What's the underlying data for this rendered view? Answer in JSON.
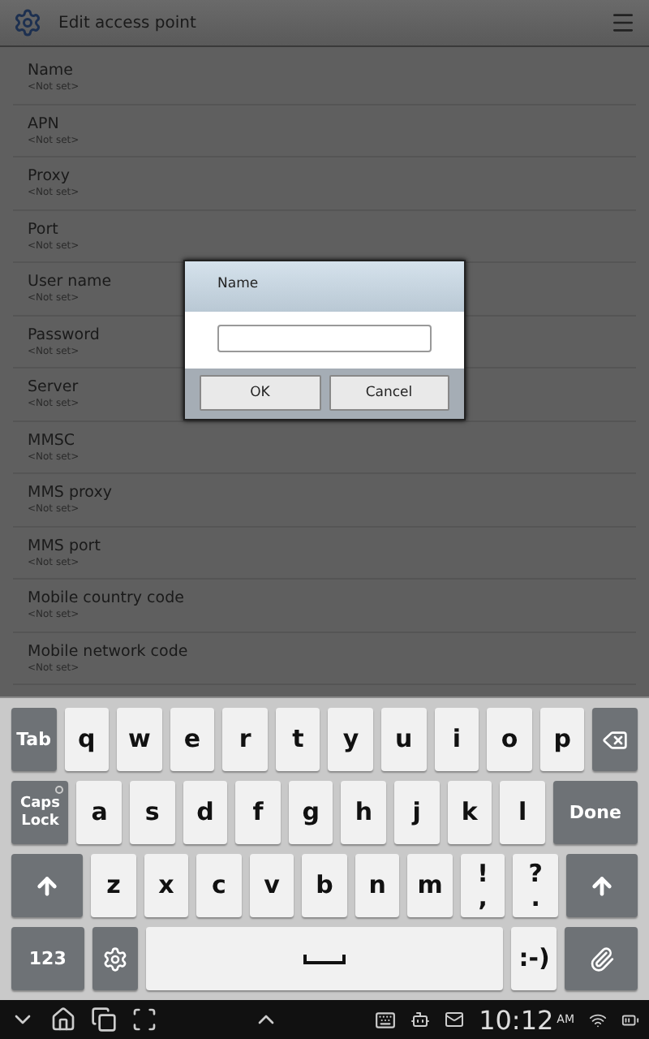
{
  "header": {
    "title": "Edit access point"
  },
  "settings": [
    {
      "label": "Name",
      "value": "<Not set>"
    },
    {
      "label": "APN",
      "value": "<Not set>"
    },
    {
      "label": "Proxy",
      "value": "<Not set>"
    },
    {
      "label": "Port",
      "value": "<Not set>"
    },
    {
      "label": "User name",
      "value": "<Not set>"
    },
    {
      "label": "Password",
      "value": "<Not set>"
    },
    {
      "label": "Server",
      "value": "<Not set>"
    },
    {
      "label": "MMSC",
      "value": "<Not set>"
    },
    {
      "label": "MMS proxy",
      "value": "<Not set>"
    },
    {
      "label": "MMS port",
      "value": "<Not set>"
    },
    {
      "label": "Mobile country code",
      "value": "<Not set>"
    },
    {
      "label": "Mobile network code",
      "value": "<Not set>"
    }
  ],
  "dialog": {
    "title": "Name",
    "buttons": [
      "OK",
      "Cancel"
    ]
  },
  "keyboard": [
    [
      {
        "kind": "function",
        "label": "Tab"
      },
      {
        "kind": "letter",
        "label": "q"
      },
      {
        "kind": "letter",
        "label": "w"
      },
      {
        "kind": "letter",
        "label": "e"
      },
      {
        "kind": "letter",
        "label": "r"
      },
      {
        "kind": "letter",
        "label": "t"
      },
      {
        "kind": "letter",
        "label": "y"
      },
      {
        "kind": "letter",
        "label": "u"
      },
      {
        "kind": "letter",
        "label": "i"
      },
      {
        "kind": "letter",
        "label": "o"
      },
      {
        "kind": "letter",
        "label": "p"
      },
      {
        "kind": "backspace"
      }
    ],
    [
      {
        "kind": "caps",
        "label": "Caps Lock",
        "on": false
      },
      {
        "kind": "letter",
        "label": "a"
      },
      {
        "kind": "letter",
        "label": "s"
      },
      {
        "kind": "letter",
        "label": "d"
      },
      {
        "kind": "letter",
        "label": "f"
      },
      {
        "kind": "letter",
        "label": "g"
      },
      {
        "kind": "letter",
        "label": "h"
      },
      {
        "kind": "letter",
        "label": "j"
      },
      {
        "kind": "letter",
        "label": "k"
      },
      {
        "kind": "letter",
        "label": "l"
      },
      {
        "kind": "function",
        "label": "Done"
      }
    ],
    [
      {
        "kind": "shift"
      },
      {
        "kind": "letter",
        "label": "z"
      },
      {
        "kind": "letter",
        "label": "x"
      },
      {
        "kind": "letter",
        "label": "c"
      },
      {
        "kind": "letter",
        "label": "v"
      },
      {
        "kind": "letter",
        "label": "b"
      },
      {
        "kind": "letter",
        "label": "n"
      },
      {
        "kind": "letter",
        "label": "m"
      },
      {
        "kind": "letter",
        "label": "!",
        "sub": ","
      },
      {
        "kind": "letter",
        "label": "?",
        "sub": "."
      },
      {
        "kind": "shift"
      }
    ],
    [
      {
        "kind": "function",
        "label": "123"
      },
      {
        "kind": "settings"
      },
      {
        "kind": "space"
      },
      {
        "kind": "letter",
        "label": ":-)"
      },
      {
        "kind": "attach"
      }
    ]
  ],
  "status_bar": {
    "time": "10:12",
    "meridiem": "AM"
  }
}
